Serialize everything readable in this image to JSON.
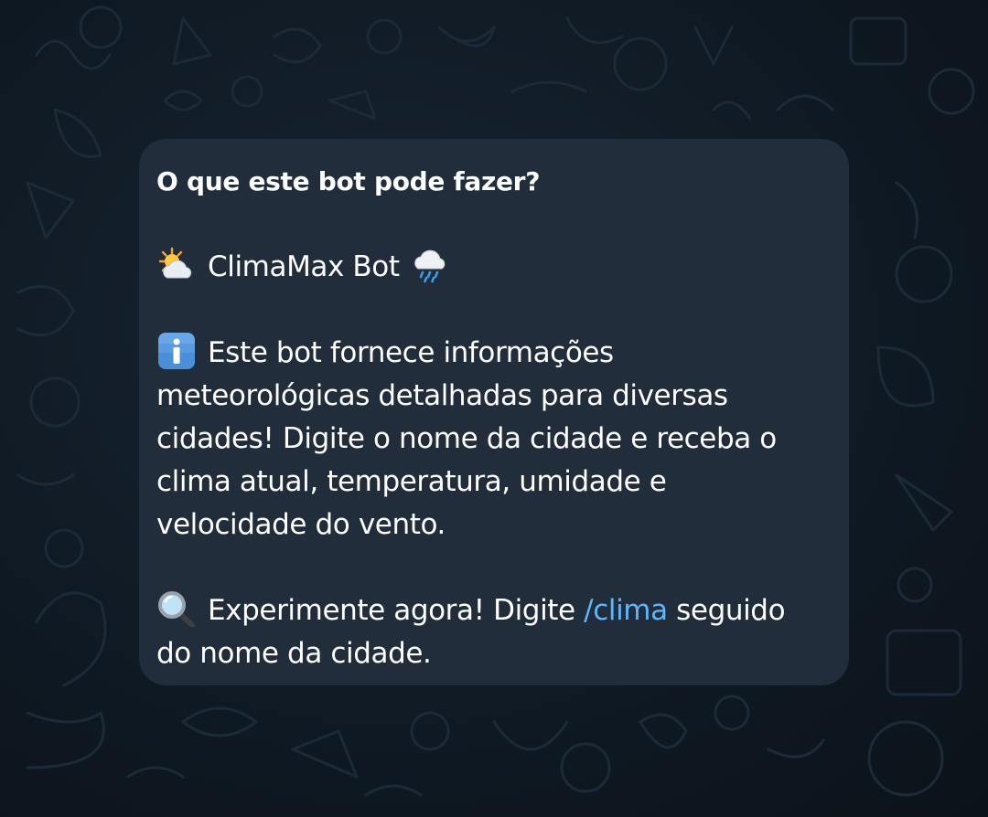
{
  "bot_info": {
    "title": "O que este bot pode fazer?",
    "bot_name": "ClimaMax Bot",
    "bot_name_icons": [
      "sun-behind-cloud-icon",
      "cloud-with-rain-icon"
    ],
    "description": {
      "icon": "information-icon",
      "lines": [
        "Este bot fornece informações",
        "meteorológicas detalhadas para diversas",
        "cidades! Digite o nome da cidade e receba o",
        "clima atual, temperatura, umidade e",
        "velocidade do vento."
      ]
    },
    "tip": {
      "icon": "magnifying-glass-icon",
      "prefix": "Experimente agora! Digite ",
      "command": "/clima",
      "suffix": " seguido",
      "line2": "do nome da cidade."
    }
  },
  "colors": {
    "background": "#0f1a24",
    "card": "#212d3b",
    "text": "#ffffff",
    "link": "#5eb5f7"
  }
}
